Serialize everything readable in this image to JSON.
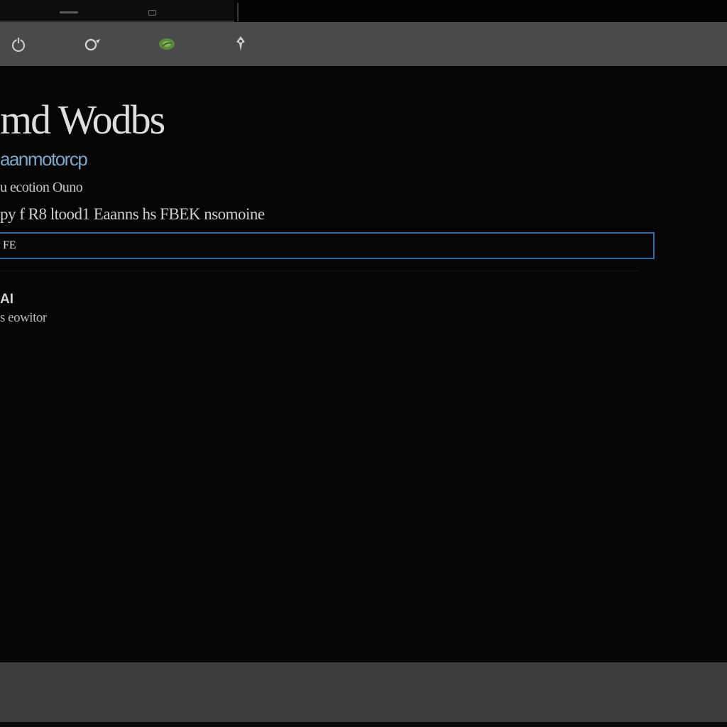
{
  "toolbar": {
    "items": [
      {
        "icon": "power-icon"
      },
      {
        "icon": "refresh-icon"
      },
      {
        "icon": "leaf-icon",
        "color": "#5c8a3a"
      },
      {
        "icon": "pin-icon"
      }
    ]
  },
  "main": {
    "title": "md Wodbs",
    "subtitle": "aanmotorcp",
    "info": "u ecotion Ouno",
    "description": "py f R8 ltood1 Eaanns hs FBEK nsomoine",
    "input": {
      "value": "FE"
    },
    "section": {
      "label": "AI",
      "value": "s eowitor"
    }
  },
  "colors": {
    "accent": "#2d6aa3",
    "link": "#7ea6c6",
    "toolbar_bg": "#4a4a4a",
    "bottom_bar_bg": "#3b3b3b"
  }
}
